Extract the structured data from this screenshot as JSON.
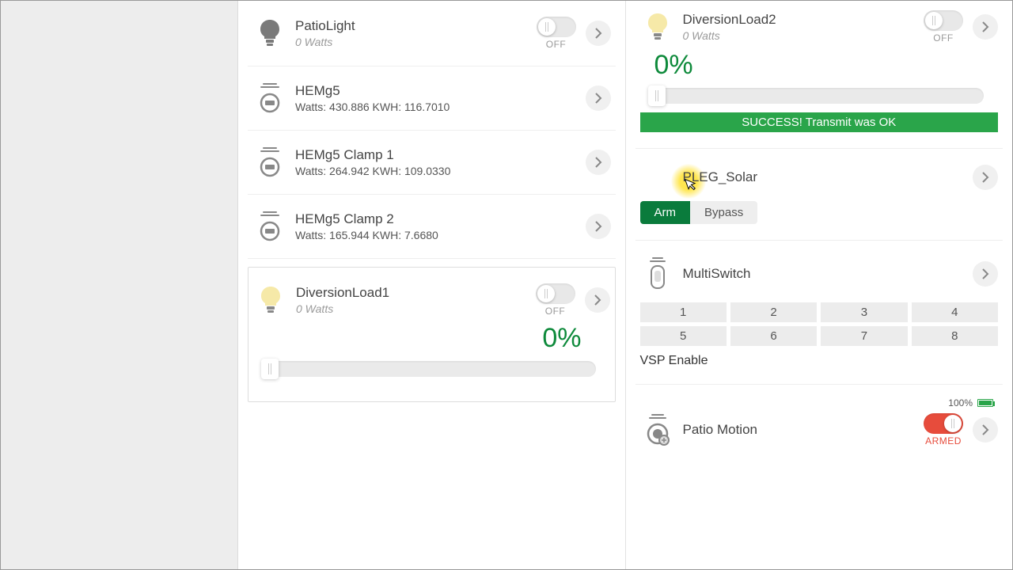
{
  "left": {
    "patio": {
      "name": "PatioLight",
      "sub": "0 Watts",
      "toggleLabel": "OFF"
    },
    "hemg5": {
      "name": "HEMg5",
      "sub": "Watts: 430.886 KWH: 116.7010"
    },
    "clamp1": {
      "name": "HEMg5 Clamp 1",
      "sub": "Watts: 264.942 KWH: 109.0330"
    },
    "clamp2": {
      "name": "HEMg5 Clamp 2",
      "sub": "Watts: 165.944 KWH: 7.6680"
    },
    "dl1": {
      "name": "DiversionLoad1",
      "sub": "0 Watts",
      "toggleLabel": "OFF",
      "pct": "0%"
    }
  },
  "right": {
    "dl2": {
      "name": "DiversionLoad2",
      "sub": "0 Watts",
      "toggleLabel": "OFF",
      "pct": "0%",
      "banner": "SUCCESS! Transmit was OK"
    },
    "pleg": {
      "name": "PLEG_Solar",
      "arm": "Arm",
      "bypass": "Bypass"
    },
    "multi": {
      "name": "MultiSwitch",
      "buttons": [
        "1",
        "2",
        "3",
        "4",
        "5",
        "6",
        "7",
        "8"
      ],
      "vsp": "VSP Enable"
    },
    "motion": {
      "name": "Patio Motion",
      "battery": "100%",
      "toggleLabel": "ARMED"
    }
  }
}
